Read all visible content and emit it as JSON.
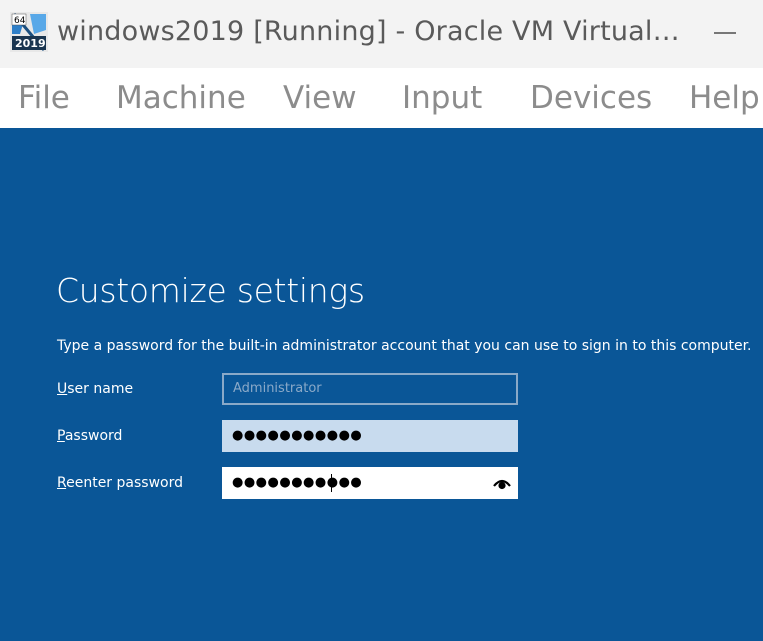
{
  "window": {
    "title": "windows2019 [Running] - Oracle VM Virtual…",
    "icon_badge_top": "64",
    "icon_badge_bottom": "2019"
  },
  "menu": {
    "items": [
      "File",
      "Machine",
      "View",
      "Input",
      "Devices",
      "Help"
    ]
  },
  "setup": {
    "heading": "Customize settings",
    "description": "Type a password for the built-in administrator account that you can use to sign in to this computer.",
    "username": {
      "label_accel": "U",
      "label_rest": "ser name",
      "placeholder": "Administrator"
    },
    "password": {
      "label_accel": "P",
      "label_rest": "assword",
      "masked_value": "●●●●●●●●●●●"
    },
    "reenter": {
      "label_accel": "R",
      "label_rest": "eenter password",
      "masked_value": "●●●●●●●●●●●"
    }
  },
  "colors": {
    "screen_bg": "#0a5697",
    "titlebar_bg": "#f3f3f3",
    "menubar_bg": "#ffffff"
  },
  "icons": {
    "app": "virtualbox-windows2019-icon",
    "minimize": "minimize-icon",
    "reveal": "eye-icon"
  }
}
